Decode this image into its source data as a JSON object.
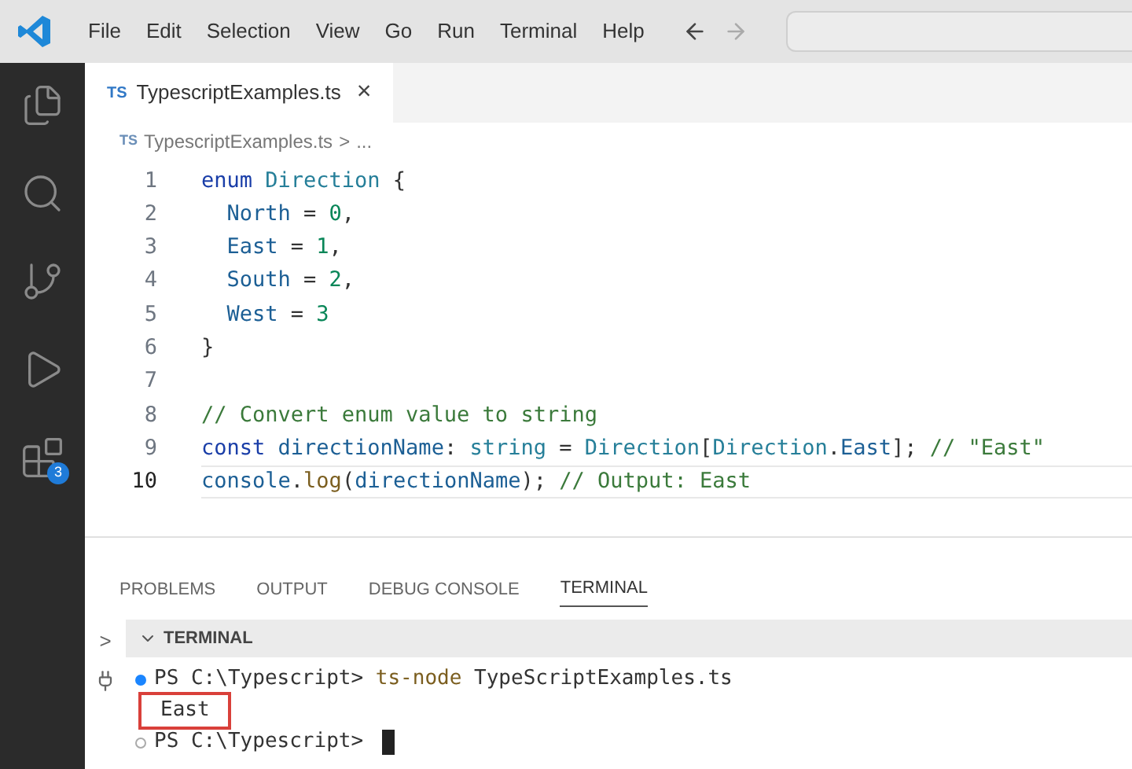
{
  "menu": [
    "File",
    "Edit",
    "Selection",
    "View",
    "Go",
    "Run",
    "Terminal",
    "Help"
  ],
  "activity_bar": [
    {
      "kind": "files",
      "selected": false
    },
    {
      "kind": "search",
      "selected": false
    },
    {
      "kind": "source-control",
      "selected": false
    },
    {
      "kind": "run",
      "selected": false
    },
    {
      "kind": "extensions",
      "selected": false,
      "badge": "3"
    }
  ],
  "tabs": [
    {
      "icon": "TS",
      "label": "TypescriptExamples.ts",
      "close": "×",
      "selected": true
    }
  ],
  "breadcrumb": {
    "icon": "TS",
    "file": "TypescriptExamples.ts",
    "separator": ">",
    "rest": "..."
  },
  "code_lines": [
    {
      "number": "1",
      "active": false,
      "tokens": [
        {
          "kind": "keyword",
          "text": "enum "
        },
        {
          "kind": "type",
          "text": "Direction "
        },
        {
          "kind": "plain",
          "text": "{"
        }
      ]
    },
    {
      "number": "2",
      "active": false,
      "indented": true,
      "tokens": [
        {
          "kind": "variable",
          "text": "North"
        },
        {
          "kind": "plain",
          "text": " = "
        },
        {
          "kind": "number",
          "text": "0"
        },
        {
          "kind": "plain",
          "text": ","
        }
      ]
    },
    {
      "number": "3",
      "active": false,
      "indented": true,
      "tokens": [
        {
          "kind": "variable",
          "text": "East"
        },
        {
          "kind": "plain",
          "text": " = "
        },
        {
          "kind": "number",
          "text": "1"
        },
        {
          "kind": "plain",
          "text": ","
        }
      ]
    },
    {
      "number": "4",
      "active": false,
      "indented": true,
      "tokens": [
        {
          "kind": "variable",
          "text": "South"
        },
        {
          "kind": "plain",
          "text": " = "
        },
        {
          "kind": "number",
          "text": "2"
        },
        {
          "kind": "plain",
          "text": ","
        }
      ]
    },
    {
      "number": "5",
      "active": false,
      "indented": true,
      "tokens": [
        {
          "kind": "variable",
          "text": "West"
        },
        {
          "kind": "plain",
          "text": " = "
        },
        {
          "kind": "number",
          "text": "3"
        }
      ]
    },
    {
      "number": "6",
      "active": false,
      "tokens": [
        {
          "kind": "plain",
          "text": "}"
        }
      ]
    },
    {
      "number": "7",
      "active": false
    },
    {
      "number": "8",
      "active": false,
      "tokens": [
        {
          "kind": "comment",
          "text": "// Convert enum value to string"
        }
      ]
    },
    {
      "number": "9",
      "active": false,
      "tokens": [
        {
          "kind": "keyword",
          "text": "const "
        },
        {
          "kind": "variable",
          "text": "directionName"
        },
        {
          "kind": "plain",
          "text": ": "
        },
        {
          "kind": "type",
          "text": "string"
        },
        {
          "kind": "plain",
          "text": " = "
        },
        {
          "kind": "type",
          "text": "Direction"
        },
        {
          "kind": "plain",
          "text": "["
        },
        {
          "kind": "type",
          "text": "Direction"
        },
        {
          "kind": "plain",
          "text": "."
        },
        {
          "kind": "variable",
          "text": "East"
        },
        {
          "kind": "plain",
          "text": "]; "
        },
        {
          "kind": "comment",
          "text": "// \"East\""
        }
      ]
    },
    {
      "number": "10",
      "active": true,
      "tokens": [
        {
          "kind": "variable",
          "text": "console"
        },
        {
          "kind": "plain",
          "text": "."
        },
        {
          "kind": "function",
          "text": "log"
        },
        {
          "kind": "plain",
          "text": "("
        },
        {
          "kind": "variable",
          "text": "directionName"
        },
        {
          "kind": "plain",
          "text": "); "
        },
        {
          "kind": "comment",
          "text": "// Output: East"
        }
      ]
    }
  ],
  "panel_tabs": [
    {
      "label": "PROBLEMS",
      "selected": false
    },
    {
      "label": "OUTPUT",
      "selected": false
    },
    {
      "label": "DEBUG CONSOLE",
      "selected": false
    },
    {
      "label": "TERMINAL",
      "selected": true
    }
  ],
  "terminal": {
    "chevron": ">",
    "header": "TERMINAL",
    "expanded": true,
    "lines": [
      {
        "kind": "command",
        "succeeded": true,
        "prompt": "PS C:\\Typescript>",
        "command": "ts-node",
        "args": "TypeScriptExamples.ts",
        "highlighted": false
      },
      {
        "kind": "output",
        "text": "East",
        "highlighted": true
      },
      {
        "kind": "prompt",
        "succeeded": false,
        "prompt": "PS C:\\Typescript>",
        "cursor": true,
        "highlighted": false
      }
    ]
  }
}
